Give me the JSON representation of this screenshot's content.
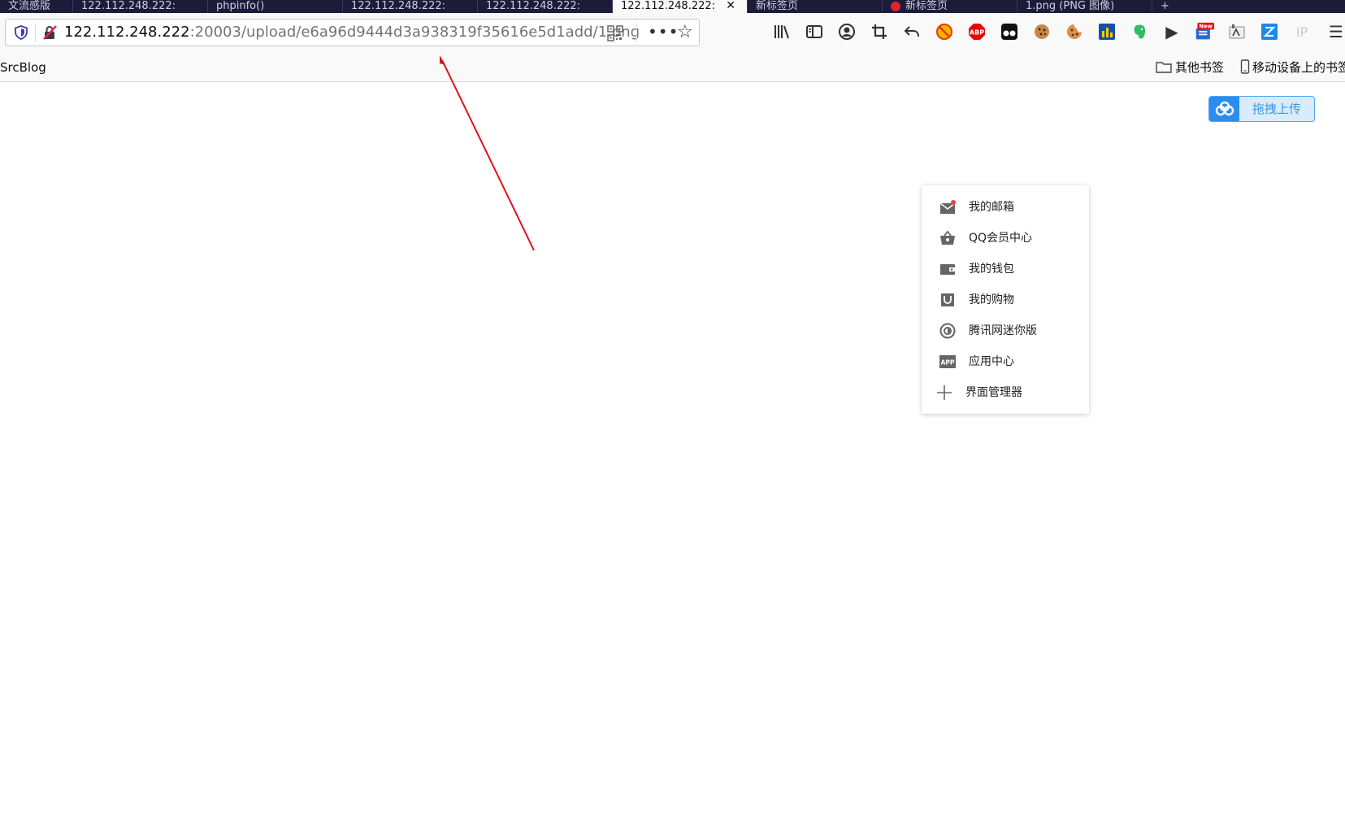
{
  "tabs": [
    {
      "label": "文流感版"
    },
    {
      "label": "122.112.248.222:"
    },
    {
      "label": "phpinfo()"
    },
    {
      "label": "122.112.248.222:"
    },
    {
      "label": "122.112.248.222:"
    },
    {
      "label": "122.112.248.222:",
      "close": "✕"
    },
    {
      "label": "新标签页"
    },
    {
      "label": "新标签页"
    },
    {
      "label": "1.png (PNG 图像)"
    },
    {
      "label": "+"
    }
  ],
  "address_bar": {
    "url_host": "122.112.248.222",
    "url_path": ":20003/upload/e6a96d9444d3a938319f35616e5d1add/1.png"
  },
  "toolbar": {
    "icons": [
      "library-icon",
      "sidebar-icon",
      "account-icon",
      "screenshot-crop-icon",
      "undo-icon",
      "blocker-icon",
      "adblock-plus-icon",
      "tampermonkey-icon",
      "cookie-icon",
      "cookie-editor-icon",
      "chart-icon",
      "evernote-icon",
      "play-icon",
      "new-badge-icon",
      "translate-icon",
      "z-icon",
      "ip-icon",
      "menu-icon"
    ],
    "abp_label": "ABP",
    "new_badge": "New",
    "ip_label": "IP",
    "play_glyph": "▶",
    "menu_glyph": "☰"
  },
  "bookmarks": {
    "left": "SrcBlog",
    "other": "其他书签",
    "mobile": "移动设备上的书签"
  },
  "upload_button": {
    "label": "拖拽上传"
  },
  "menu": {
    "items": [
      {
        "label": "我的邮箱",
        "icon": "mail-icon"
      },
      {
        "label": "QQ会员中心",
        "icon": "vip-basket-icon"
      },
      {
        "label": "我的钱包",
        "icon": "wallet-icon"
      },
      {
        "label": "我的购物",
        "icon": "shopping-bag-icon"
      },
      {
        "label": "腾讯网迷你版",
        "icon": "tencent-mini-icon"
      },
      {
        "label": "应用中心",
        "icon": "app-icon"
      },
      {
        "label": "界面管理器",
        "icon": "plus-icon"
      }
    ]
  },
  "colors": {
    "tabstrip": "#1c1b3a",
    "annotation_arrow": "#e3101e",
    "upload_accent": "#2d8cf0",
    "menu_icon": "#666666",
    "mail_dot": "#f04040"
  }
}
